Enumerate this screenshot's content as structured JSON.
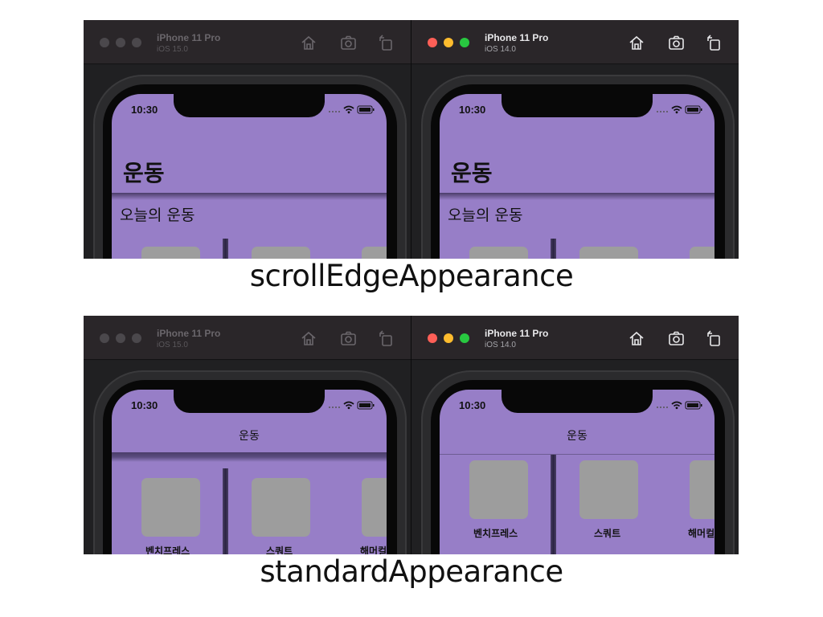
{
  "sections": [
    {
      "caption": "scrollEdgeAppearance",
      "left": {
        "device": "iPhone 11 Pro",
        "os": "iOS 15.0",
        "active": false,
        "time": "10:30",
        "large_title": "운동",
        "section_title": "오늘의 운동",
        "items": [
          "",
          "",
          ""
        ]
      },
      "right": {
        "device": "iPhone 11 Pro",
        "os": "iOS 14.0",
        "active": true,
        "time": "10:30",
        "large_title": "운동",
        "section_title": "오늘의 운동",
        "items": [
          "",
          "",
          ""
        ]
      }
    },
    {
      "caption": "standardAppearance",
      "left": {
        "device": "iPhone 11 Pro",
        "os": "iOS 15.0",
        "active": false,
        "time": "10:30",
        "inline_title": "운동",
        "items": [
          "벤치프레스",
          "스쿼트",
          "해머컬"
        ]
      },
      "right": {
        "device": "iPhone 11 Pro",
        "os": "iOS 14.0",
        "active": true,
        "time": "10:30",
        "inline_title": "운동",
        "items": [
          "벤치프레스",
          "스쿼트",
          "해머컬"
        ]
      }
    }
  ],
  "toolbar_icons": [
    "home-icon",
    "screenshot-icon",
    "rotate-icon"
  ],
  "colors": {
    "screen_bg": "#977ec7",
    "card": "#9d9d9d",
    "traffic_red": "#fe5f57",
    "traffic_yellow": "#febc2e",
    "traffic_green": "#28c840",
    "traffic_inactive": "#4b484c"
  }
}
